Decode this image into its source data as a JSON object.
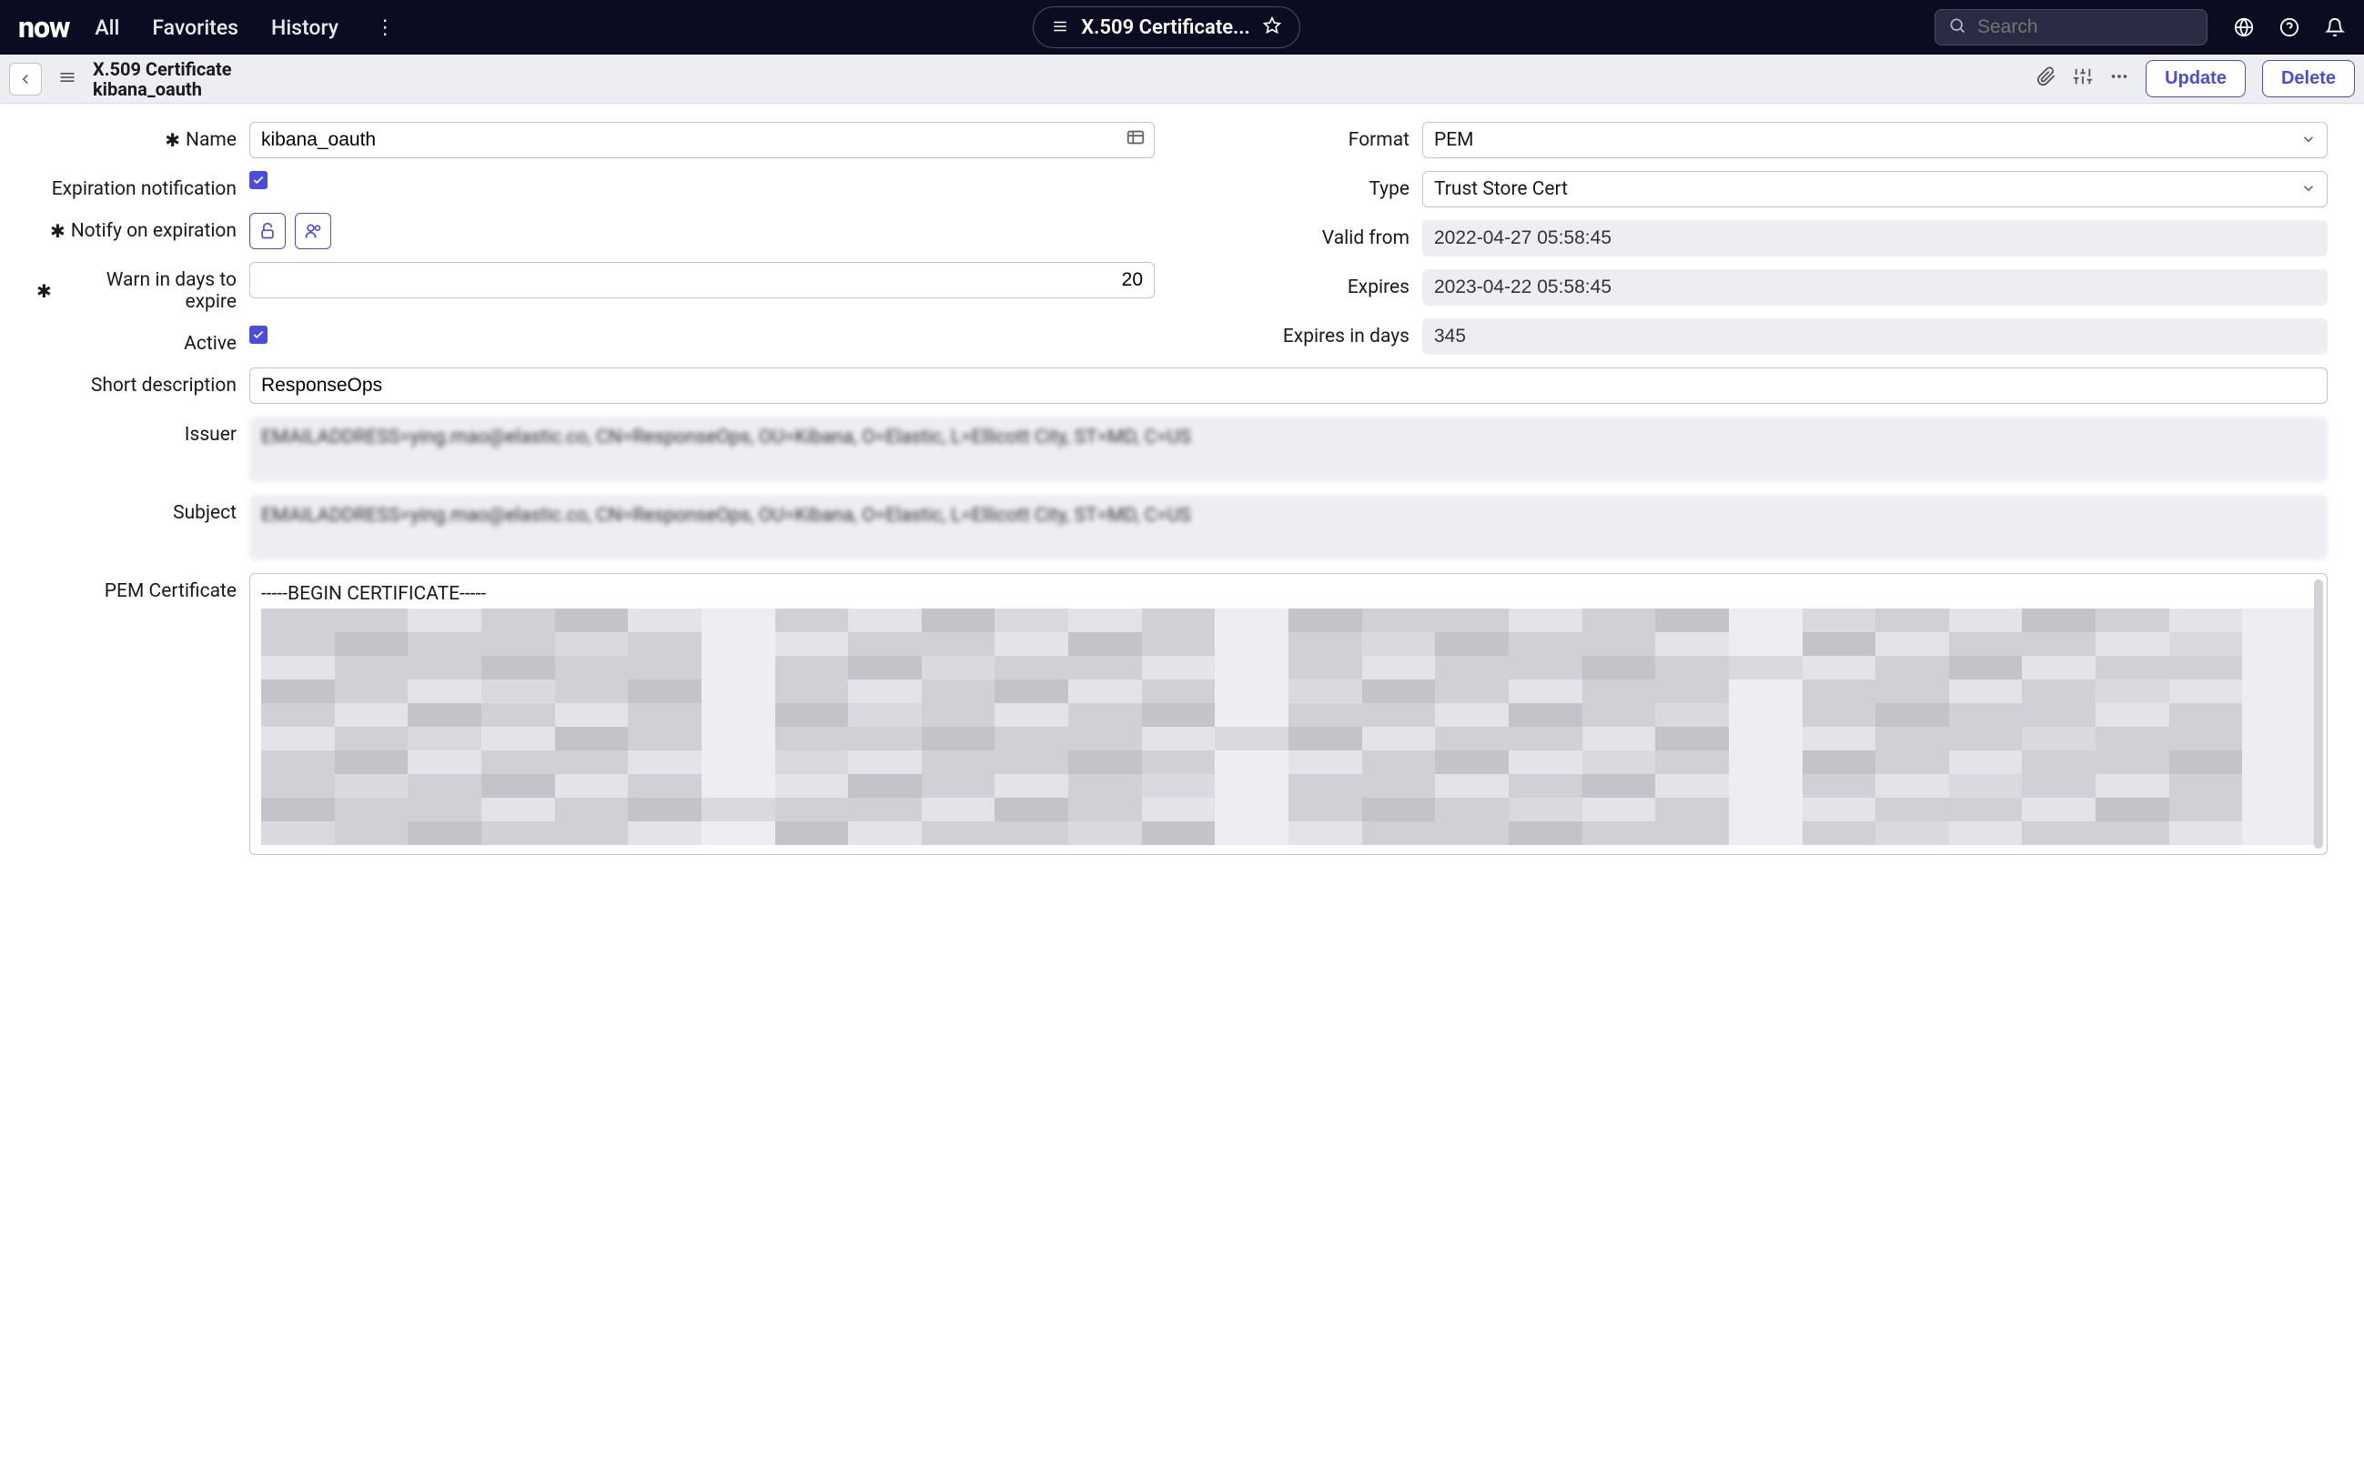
{
  "topnav": {
    "logo": "now",
    "items": [
      "All",
      "Favorites",
      "History"
    ],
    "breadcrumb": "X.509 Certificate...",
    "search_placeholder": "Search"
  },
  "subheader": {
    "title_line1": "X.509 Certificate",
    "title_line2": "kibana_oauth",
    "update_label": "Update",
    "delete_label": "Delete"
  },
  "form": {
    "name_label": "Name",
    "name_value": "kibana_oauth",
    "expiration_notification_label": "Expiration notification",
    "expiration_notification_checked": true,
    "notify_on_expiration_label": "Notify on expiration",
    "warn_days_label": "Warn in days to expire",
    "warn_days_value": "20",
    "active_label": "Active",
    "active_checked": true,
    "format_label": "Format",
    "format_value": "PEM",
    "type_label": "Type",
    "type_value": "Trust Store Cert",
    "valid_from_label": "Valid from",
    "valid_from_value": "2022-04-27 05:58:45",
    "expires_label": "Expires",
    "expires_value": "2023-04-22 05:58:45",
    "expires_in_days_label": "Expires in days",
    "expires_in_days_value": "345",
    "short_description_label": "Short description",
    "short_description_value": "ResponseOps",
    "issuer_label": "Issuer",
    "issuer_value": "EMAILADDRESS=ying.mao@elastic.co, CN=ResponseOps, OU=Kibana, O=Elastic, L=Ellicott City, ST=MD, C=US",
    "subject_label": "Subject",
    "subject_value": "EMAILADDRESS=ying.mao@elastic.co, CN=ResponseOps, OU=Kibana, O=Elastic, L=Ellicott City, ST=MD, C=US",
    "pem_label": "PEM Certificate",
    "pem_header": "-----BEGIN CERTIFICATE-----"
  }
}
